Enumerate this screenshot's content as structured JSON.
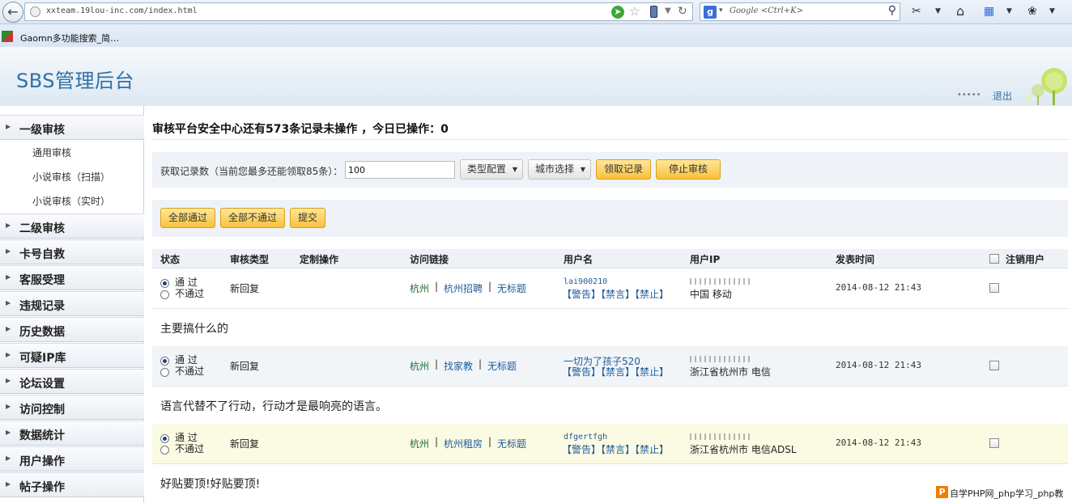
{
  "browser": {
    "url": "xxteam.19lou-inc.com/index.html",
    "search_placeholder": "Google <Ctrl+K>",
    "bookmark": "Gaomn多功能搜索_简…"
  },
  "header": {
    "logo": "SBS管理后台",
    "logout": "退出"
  },
  "sidebar": {
    "groups": [
      {
        "label": "一级审核",
        "children": [
          "通用审核",
          "小说审核（扫描）",
          "小说审核（实时）"
        ]
      },
      {
        "label": "二级审核"
      },
      {
        "label": "卡号自救"
      },
      {
        "label": "客服受理"
      },
      {
        "label": "违规记录"
      },
      {
        "label": "历史数据"
      },
      {
        "label": "可疑IP库"
      },
      {
        "label": "论坛设置"
      },
      {
        "label": "访问控制"
      },
      {
        "label": "数据统计"
      },
      {
        "label": "用户操作"
      },
      {
        "label": "帖子操作"
      }
    ]
  },
  "main": {
    "title": "审核平台安全中心还有573条记录未操作 ，今日已操作：0",
    "fetch": {
      "label": "获取记录数（当前您最多还能领取85条）：",
      "value": "100",
      "type_config": "类型配置",
      "city_select": "城市选择",
      "get_records": "领取记录",
      "stop_review": "停止审核"
    },
    "actions": {
      "all_pass": "全部通过",
      "all_fail": "全部不通过",
      "submit": "提交"
    },
    "table": {
      "headers": {
        "status": "状态",
        "type": "审核类型",
        "custom": "定制操作",
        "link": "访问链接",
        "username": "用户名",
        "ip": "用户IP",
        "time": "发表时间",
        "cancel_user": "注销用户"
      },
      "pass_label": "通  过",
      "fail_label": "不通过",
      "rows": [
        {
          "type": "新回复",
          "links": [
            "杭州",
            "杭州招聘",
            "无标题"
          ],
          "username": "lai900210",
          "actions": "【警告】【禁言】【禁止】",
          "location": "中国 移动",
          "time": "2014-08-12 21:43",
          "content": "主要搞什么的"
        },
        {
          "type": "新回复",
          "links": [
            "杭州",
            "找家教",
            "无标题"
          ],
          "username": "一切为了孩子520",
          "actions": "【警告】【禁言】【禁止】",
          "location": "浙江省杭州市 电信",
          "time": "2014-08-12 21:43",
          "content": "语言代替不了行动，行动才是最响亮的语言。"
        },
        {
          "type": "新回复",
          "links": [
            "杭州",
            "杭州租房",
            "无标题"
          ],
          "username": "dfgertfgh",
          "actions": "【警告】【禁言】【禁止】",
          "location": "浙江省杭州市 电信ADSL",
          "time": "2014-08-12 21:43",
          "content": "好贴要顶!好贴要顶!"
        }
      ]
    }
  },
  "watermark": "自学PHP网_php学习_php教"
}
